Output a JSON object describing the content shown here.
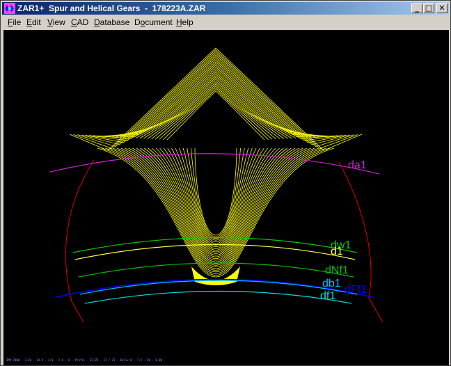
{
  "window": {
    "title": "ZAR1+  Spur and Helical Gears  -  178223A.ZAR",
    "controls": {
      "minimize": "_",
      "maximize": "□",
      "close": "✕"
    }
  },
  "menu": {
    "items": [
      {
        "pre": "",
        "mn": "F",
        "post": "ile"
      },
      {
        "pre": "",
        "mn": "E",
        "post": "dit"
      },
      {
        "pre": "",
        "mn": "V",
        "post": "iew"
      },
      {
        "pre": "",
        "mn": "C",
        "post": "AD"
      },
      {
        "pre": "",
        "mn": "D",
        "post": "atabase"
      },
      {
        "pre": "D",
        "mn": "o",
        "post": "cument"
      },
      {
        "pre": "",
        "mn": "H",
        "post": "elp"
      }
    ]
  },
  "drawing": {
    "labels": {
      "da1": "da1",
      "dw1": "dw1",
      "d1": "d1",
      "dNf1": "dNf1",
      "db1": "db1",
      "dFf1": "dFf1",
      "df1": "df1"
    },
    "colors": {
      "background": "#000000",
      "tooth": "#ffff00",
      "da1": "#d020d0",
      "dw1": "#00d000",
      "d1": "#ffff40",
      "dNf1": "#00c000",
      "db1": "#00c0ff",
      "dFf1": "#0000ff",
      "df1": "#00e0e0",
      "outline": "#e00000"
    },
    "status": "IMP:7000 - 3.46 - 14.5 - 4.0 - 2.4 - 8 - Profil - Z1/Z2 - 17 / 23 - Helix 0 - 7.2 - 20 - 0.00"
  }
}
